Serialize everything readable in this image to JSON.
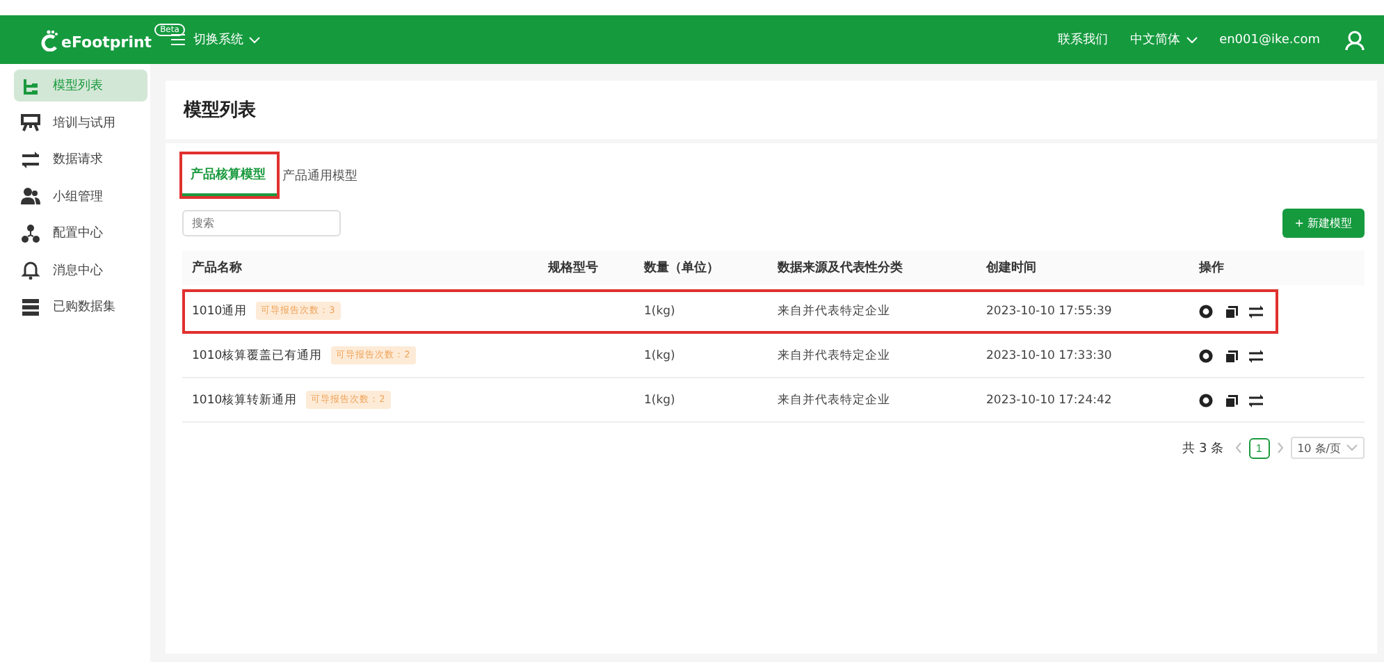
{
  "header": {
    "logo": "eFootprint",
    "beta": "Beta",
    "switch_label": "切换系统",
    "contact": "联系我们",
    "language": "中文简体",
    "user": "en001@ike.com"
  },
  "sidebar": {
    "items": [
      {
        "label": "模型列表",
        "selected": true
      },
      {
        "label": "培训与试用",
        "selected": false
      },
      {
        "label": "数据请求",
        "selected": false
      },
      {
        "label": "小组管理",
        "selected": false
      },
      {
        "label": "配置中心",
        "selected": false
      },
      {
        "label": "消息中心",
        "selected": false
      },
      {
        "label": "已购数据集",
        "selected": false
      }
    ]
  },
  "page_title": "模型列表",
  "tabs": [
    {
      "label": "产品核算模型",
      "selected": true,
      "annotated": true
    },
    {
      "label": "产品通用模型",
      "selected": false,
      "annotated": false
    }
  ],
  "search": {
    "placeholder": "搜索"
  },
  "new_button": "+ 新建模型",
  "table": {
    "columns": [
      "产品名称",
      "规格型号",
      "数量（单位）",
      "数据来源及代表性分类",
      "创建时间",
      "操作"
    ],
    "rows": [
      {
        "name": "1010通用",
        "tag": "可导报告次数：3",
        "quantity": "1(kg)",
        "source": "来自并代表特定企业",
        "created": "2023-10-10 17:55:39",
        "annotated": true
      },
      {
        "name": "1010核算覆盖已有通用",
        "tag": "可导报告次数：2",
        "quantity": "1(kg)",
        "source": "来自并代表特定企业",
        "created": "2023-10-10 17:33:30",
        "annotated": false
      },
      {
        "name": "1010核算转新通用",
        "tag": "可导报告次数：2",
        "quantity": "1(kg)",
        "source": "来自并代表特定企业",
        "created": "2023-10-10 17:24:42",
        "annotated": false
      }
    ]
  },
  "pagination": {
    "total": "共 3 条",
    "pages": [
      {
        "label": "1",
        "selected": true
      }
    ],
    "page_size": "10 条/页"
  }
}
